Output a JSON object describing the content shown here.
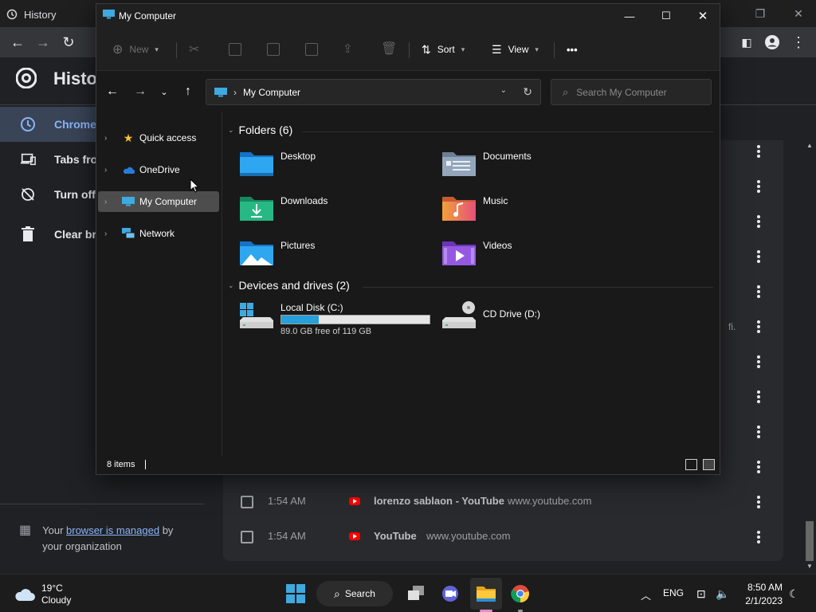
{
  "chrome": {
    "tab_title": "History",
    "page_title": "History",
    "sidebar": [
      {
        "label": "Chrome history",
        "icon": "clock-icon",
        "active": true
      },
      {
        "label": "Tabs from other devices",
        "icon": "devices-icon",
        "active": false
      },
      {
        "label": "Turn off Chrome Sync",
        "icon": "sync-off-icon",
        "active": false
      },
      {
        "label": "Clear browsing data",
        "icon": "trash-icon",
        "active": false
      }
    ],
    "managed_prefix": "Your ",
    "managed_link": "browser is managed",
    "managed_suffix": " by your organization",
    "partial_url_fragment": "fi.",
    "rows": [
      {
        "time": "1:54 AM",
        "title": "lorenzo sablaon - YouTube",
        "url": "www.youtube.com"
      },
      {
        "time": "1:54 AM",
        "title": "YouTube",
        "url": "www.youtube.com"
      }
    ]
  },
  "explorer": {
    "title": "My Computer",
    "commands": {
      "new": "New",
      "sort": "Sort",
      "view": "View",
      "more": "•••"
    },
    "address": {
      "location": "My Computer",
      "separator": "›"
    },
    "search_placeholder": "Search My Computer",
    "nav": [
      {
        "label": "Quick access",
        "icon": "star-icon",
        "selected": false
      },
      {
        "label": "OneDrive",
        "icon": "cloud-icon",
        "selected": false
      },
      {
        "label": "My Computer",
        "icon": "computer-icon",
        "selected": true
      },
      {
        "label": "Network",
        "icon": "network-icon",
        "selected": false
      }
    ],
    "folders_header": "Folders (6)",
    "folders": [
      {
        "name": "Desktop",
        "icon": "desktop-folder-icon",
        "color": "#1e90ff"
      },
      {
        "name": "Documents",
        "icon": "documents-folder-icon",
        "color": "#8fa3b8"
      },
      {
        "name": "Downloads",
        "icon": "downloads-folder-icon",
        "color": "#22b07d"
      },
      {
        "name": "Music",
        "icon": "music-folder-icon",
        "color": "#f07a4a"
      },
      {
        "name": "Pictures",
        "icon": "pictures-folder-icon",
        "color": "#2aa0e6"
      },
      {
        "name": "Videos",
        "icon": "videos-folder-icon",
        "color": "#8a4fd8"
      }
    ],
    "drives_header": "Devices and drives (2)",
    "drives": [
      {
        "name": "Local Disk (C:)",
        "free_text": "89.0 GB free of 119 GB",
        "used_fraction": 0.252
      },
      {
        "name": "CD Drive (D:)"
      }
    ],
    "status": "8 items"
  },
  "taskbar": {
    "weather_temp": "19°C",
    "weather_desc": "Cloudy",
    "search_label": "Search",
    "lang": "ENG",
    "time": "8:50 AM",
    "date": "2/1/2023"
  }
}
